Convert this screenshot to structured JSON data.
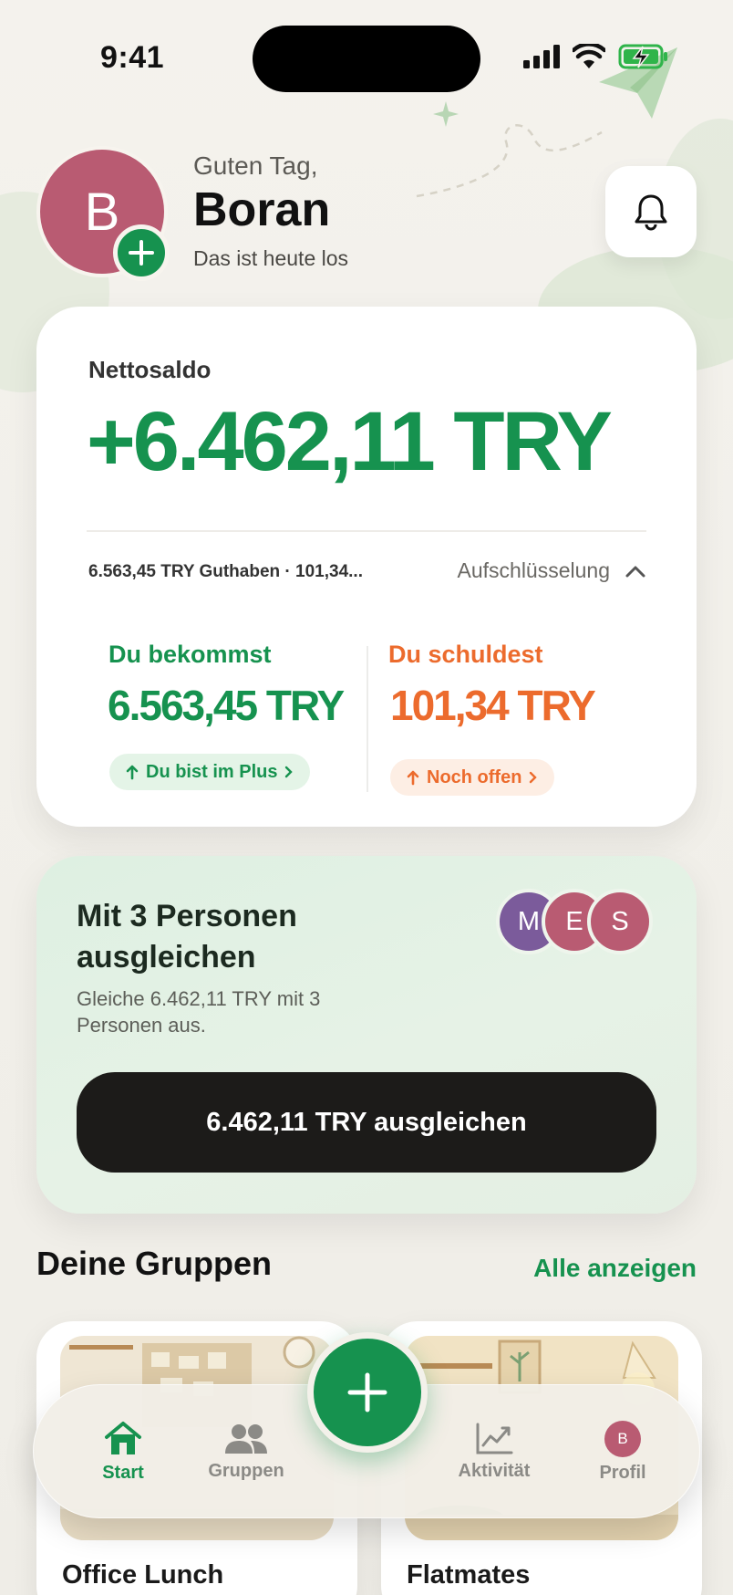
{
  "status_bar": {
    "time": "9:41"
  },
  "header": {
    "avatar_initial": "B",
    "greeting": "Guten Tag,",
    "name": "Boran",
    "subtitle": "Das ist heute los"
  },
  "balance": {
    "label": "Nettosaldo",
    "amount": "+6.462,11 TRY",
    "summary": "6.563,45 TRY Guthaben · 101,34...",
    "breakdown_label": "Aufschlüsselung",
    "receive": {
      "title": "Du bekommst",
      "amount": "6.563,45 TRY",
      "pill": "Du bist im Plus"
    },
    "owe": {
      "title": "Du schuldest",
      "amount": "101,34 TRY",
      "pill": "Noch offen"
    }
  },
  "settle": {
    "title": "Mit 3 Personen ausgleichen",
    "description": "Gleiche 6.462,11 TRY mit 3 Personen aus.",
    "avatars": [
      {
        "initial": "M",
        "color": "#7b5b9b"
      },
      {
        "initial": "E",
        "color": "#b95b72"
      },
      {
        "initial": "S",
        "color": "#b95b72"
      }
    ],
    "button_label": "6.462,11 TRY ausgleichen"
  },
  "groups": {
    "title": "Deine Gruppen",
    "see_all": "Alle anzeigen",
    "items": [
      {
        "name": "Office Lunch"
      },
      {
        "name": "Flatmates"
      }
    ]
  },
  "tabbar": {
    "items": [
      {
        "label": "Start",
        "icon": "home-icon",
        "active": true
      },
      {
        "label": "Gruppen",
        "icon": "people-icon",
        "active": false
      },
      {
        "label": "Aktivität",
        "icon": "chart-icon",
        "active": false
      },
      {
        "label": "Profil",
        "icon": "avatar",
        "active": false,
        "initial": "B"
      }
    ]
  },
  "colors": {
    "brand_green": "#16924f",
    "owe_orange": "#ec6b2d",
    "avatar_rose": "#b95b72",
    "dark_button": "#1c1b19"
  }
}
